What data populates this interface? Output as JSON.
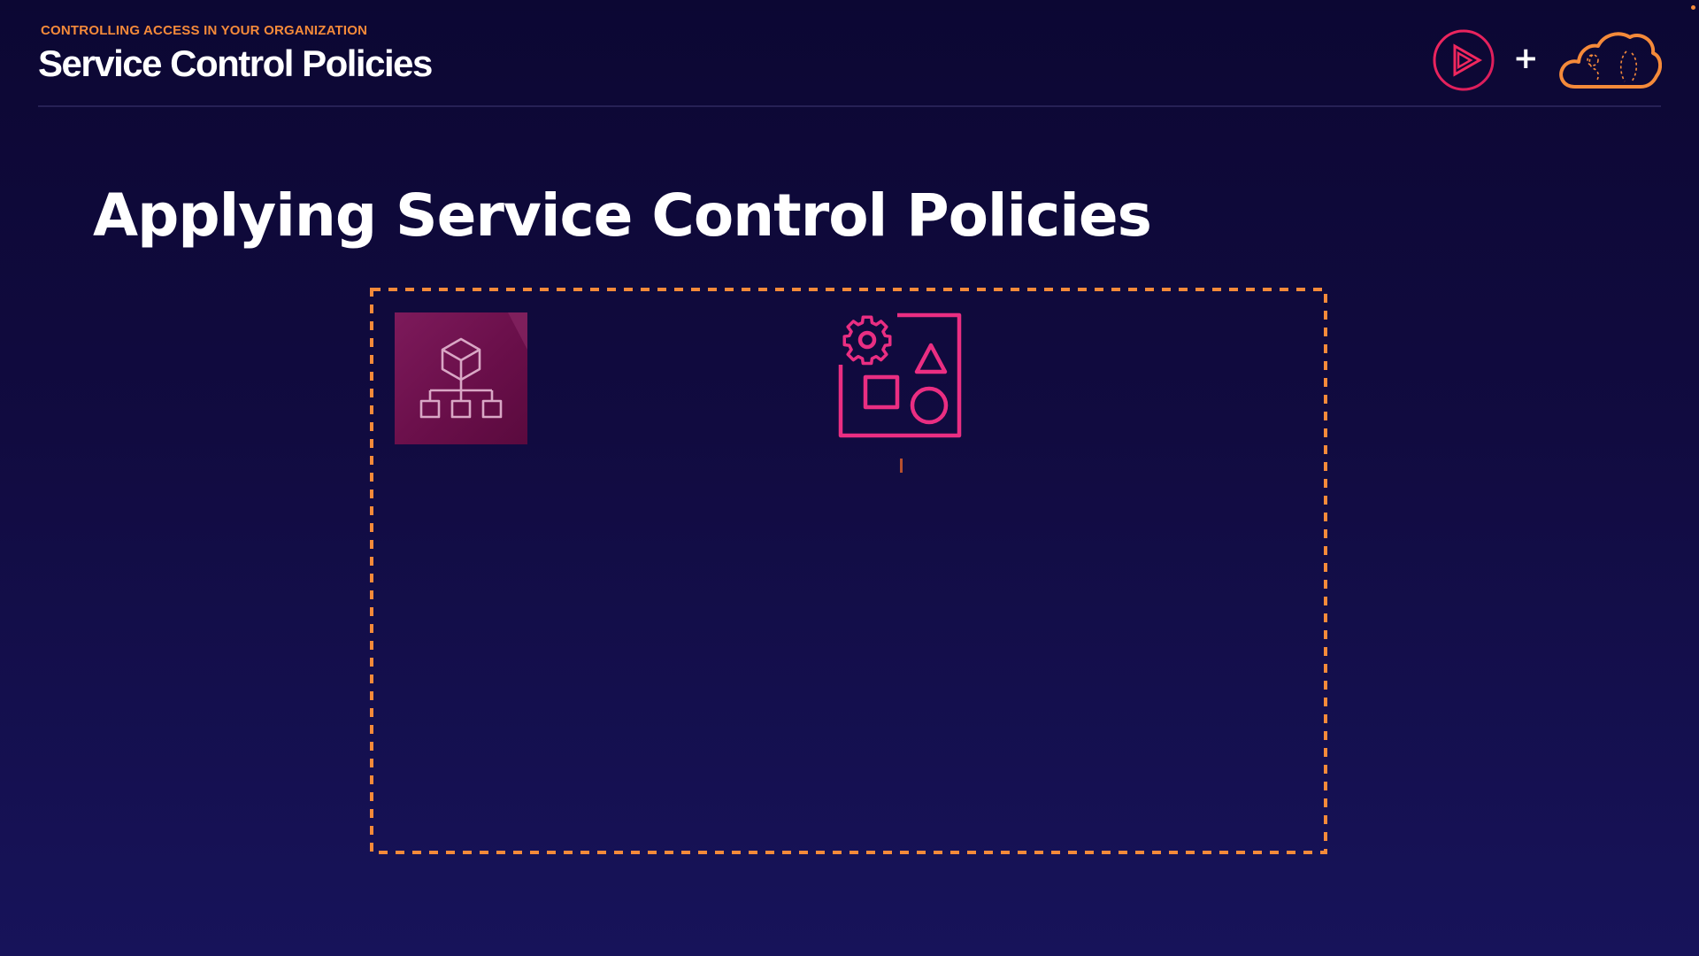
{
  "header": {
    "kicker": "CONTROLLING ACCESS IN YOUR ORGANIZATION",
    "title": "Service Control Policies"
  },
  "brand": {
    "icons": [
      "pluralsight-play-icon",
      "plus-icon",
      "cloud-logo-icon"
    ],
    "plus": "+"
  },
  "slide": {
    "title": "Applying Service Control Policies"
  },
  "diagram": {
    "boundary_style": "dashed",
    "icons": [
      "aws-organizations-icon",
      "service-catalog-icon"
    ]
  },
  "colors": {
    "background": "#0c0733",
    "accent_orange": "#f58a3a",
    "accent_pink": "#e0206f",
    "organizations_tile": "#7d1a5b"
  }
}
